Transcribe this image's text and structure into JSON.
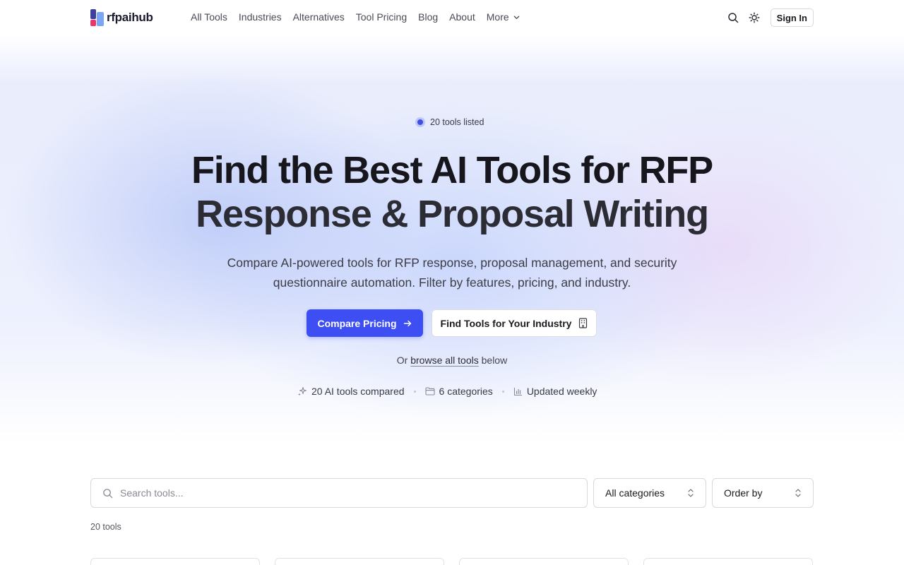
{
  "brand": {
    "name": "rfpaihub"
  },
  "nav": {
    "items": [
      "All Tools",
      "Industries",
      "Alternatives",
      "Tool Pricing",
      "Blog",
      "About"
    ],
    "more_label": "More",
    "sign_in": "Sign In"
  },
  "hero": {
    "badge": "20 tools listed",
    "title_line1": "Find the Best AI Tools for RFP",
    "title_line2": "Response & Proposal Writing",
    "subtitle": "Compare AI-powered tools for RFP response, proposal management, and security questionnaire automation. Filter by features, pricing, and industry.",
    "primary_cta": "Compare Pricing",
    "secondary_cta": "Find Tools for Your Industry",
    "browse_prefix": "Or",
    "browse_link": "browse all tools",
    "browse_suffix": "below",
    "stats": [
      "20 AI tools compared",
      "6 categories",
      "Updated weekly"
    ]
  },
  "filters": {
    "search_placeholder": "Search tools...",
    "category_value": "All categories",
    "order_value": "Order by"
  },
  "results": {
    "count": "20 tools"
  },
  "colors": {
    "accent": "#3d4ef2",
    "text": "#16161c"
  }
}
